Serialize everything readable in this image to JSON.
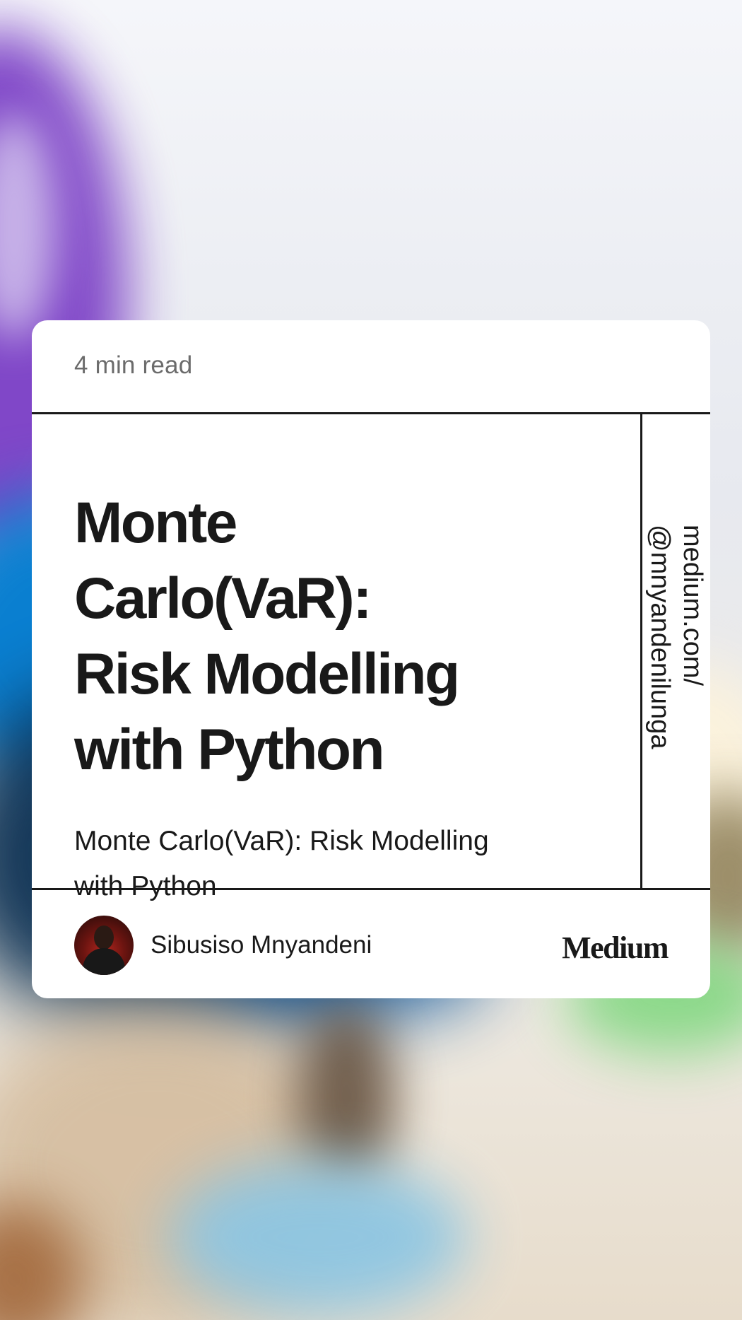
{
  "card": {
    "read_time": "4 min read",
    "title": "Monte Carlo(VaR): Risk Modelling with Python",
    "subtitle": "Monte Carlo(VaR): Risk Modelling with Python",
    "side_url_line1": "medium.com/",
    "side_url_line2": "@mnyandenilunga",
    "author_name": "Sibusiso Mnyandeni",
    "brand": "Medium"
  }
}
